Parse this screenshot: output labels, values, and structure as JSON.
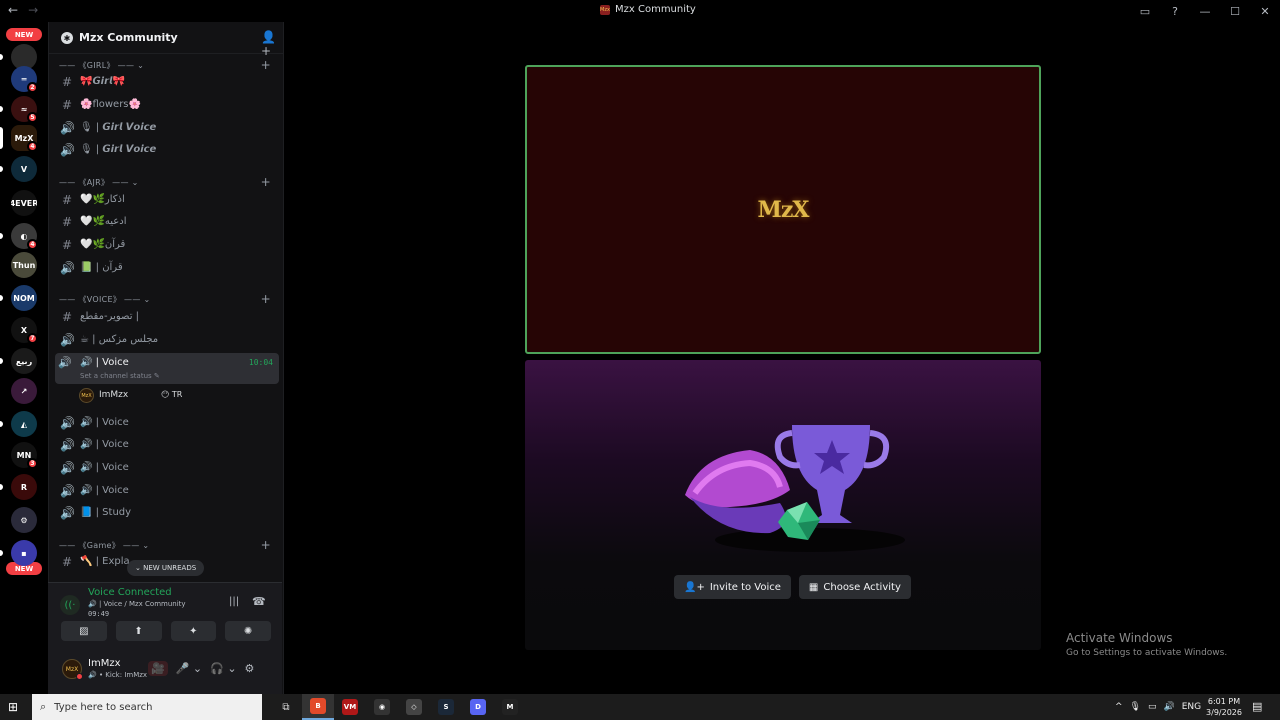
{
  "titlebar": {
    "title": "Mzx Community",
    "back": "←",
    "forward": "→",
    "logo_text": "Mzx",
    "controls": [
      "▭",
      "?",
      "—",
      "☐",
      "✕"
    ]
  },
  "rail": {
    "new_top": "NEW",
    "new_bottom": "NEW",
    "servers": [
      {
        "label": "",
        "color": "#2a2a2a",
        "badge": ""
      },
      {
        "label": "═",
        "color": "#1f3a7a",
        "badge": "2"
      },
      {
        "label": "≈",
        "color": "#3a1010",
        "badge": "5"
      },
      {
        "label": "MzX",
        "color": "#2b1a0a",
        "badge": "4"
      },
      {
        "label": "V",
        "color": "#0e2a3a",
        "badge": ""
      },
      {
        "label": "4EVER",
        "color": "#111111",
        "badge": ""
      },
      {
        "label": "◐",
        "color": "#3a3a3a",
        "badge": "4"
      },
      {
        "label": "Thun",
        "color": "#4a4a3a",
        "badge": ""
      },
      {
        "label": "NOM",
        "color": "#1a3a6a",
        "badge": ""
      },
      {
        "label": "X",
        "color": "#111111",
        "badge": "7"
      },
      {
        "label": "ربيع",
        "color": "#1a1a1a",
        "badge": ""
      },
      {
        "label": "↗",
        "color": "#3a1a3a",
        "badge": ""
      },
      {
        "label": "◭",
        "color": "#0e3a4a",
        "badge": ""
      },
      {
        "label": "MN",
        "color": "#111111",
        "badge": "3"
      },
      {
        "label": "R",
        "color": "#3a0a0a",
        "badge": ""
      },
      {
        "label": "⚙",
        "color": "#2a2a3a",
        "badge": ""
      },
      {
        "label": "▪",
        "color": "#3a3aaa",
        "badge": ""
      }
    ]
  },
  "guild": {
    "name": "Mzx Community",
    "chevron": "⌄",
    "invite_icon": "👤+"
  },
  "categories": [
    {
      "label": "—— 《GIRL》 —— ⌄"
    },
    {
      "label": "—— 《AJR》 —— ⌄"
    },
    {
      "label": "—— 《VOICE》 —— ⌄"
    },
    {
      "label": "—— 《Game》 —— ⌄"
    }
  ],
  "channels": {
    "girl": [
      {
        "icon": "#",
        "name": "🎀𝙂𝙞𝙧𝙡🎀"
      },
      {
        "icon": "#",
        "name": "🌸flowers🌸"
      },
      {
        "icon": "🔊",
        "name": "🎙 | 𝙂𝙞𝙧𝙡 𝙑𝙤𝙞𝙘𝙚"
      },
      {
        "icon": "🔊",
        "name": "🎙 | 𝙂𝙞𝙧𝙡 𝙑𝙤𝙞𝙘𝙚"
      }
    ],
    "ajr": [
      {
        "icon": "#",
        "name": "🤍🌿اذكار"
      },
      {
        "icon": "#",
        "name": "🤍🌿ادعيه"
      },
      {
        "icon": "#",
        "name": "🤍🌿قرآن"
      },
      {
        "icon": "🔊",
        "name": "📗 | قرآن"
      }
    ],
    "voice_text": [
      {
        "icon": "#",
        "name": "تصوير-مقطع |"
      },
      {
        "icon": "🔊",
        "name": "☕ | مجلس مزكس"
      }
    ],
    "active": {
      "icon": "🔊",
      "name": "🔊 | Voice",
      "time": "10:04",
      "status": "Set a channel status ✎"
    },
    "voice_user": {
      "avatar": "MzX",
      "name": "ImMzx",
      "tag": "😶 TR"
    },
    "voice_rest": [
      {
        "icon": "🔊",
        "name": "🔊 | Voice"
      },
      {
        "icon": "🔊",
        "name": "🔊 | Voice"
      },
      {
        "icon": "🔊",
        "name": "🔊 | Voice"
      },
      {
        "icon": "🔊",
        "name": "🔊 | Voice"
      },
      {
        "icon": "🔊",
        "name": "📘 | Study"
      }
    ],
    "game": [
      {
        "icon": "#",
        "name": "🪓 | Expla"
      }
    ]
  },
  "new_unreads": "⌄ NEW UNREADS",
  "voice_panel": {
    "title": "Voice Connected",
    "subtitle": "🔊 | Voice / Mzx Community",
    "time": "09:49",
    "signal_icon": "((·",
    "wave_icon": "|||",
    "hangup_icon": "☎",
    "buttons": [
      "▨",
      "⬆",
      "✦",
      "✺"
    ]
  },
  "user_panel": {
    "avatar": "MzX",
    "name": "ImMzx",
    "sub": "🔊 • Kick: ImMzx",
    "icons": [
      "🎥",
      "🎤 ⌄",
      "🎧 ⌄",
      "⚙"
    ]
  },
  "stage": {
    "tile_logo": "MzX",
    "invite_label": "Invite to Voice",
    "activity_label": "Choose Activity",
    "invite_icon": "👤+",
    "activity_icon": "▦"
  },
  "watermark": {
    "line1": "Activate Windows",
    "line2": "Go to Settings to activate Windows."
  },
  "taskbar": {
    "start_icon": "⊞",
    "search_placeholder": "Type here to search",
    "search_icon": "⌕",
    "taskview_icon": "⧉",
    "apps": [
      {
        "name": "brave",
        "label": "B",
        "color": "#e24a2a",
        "active": true
      },
      {
        "name": "voicemeeter",
        "label": "VM",
        "color": "#b01818",
        "active": false
      },
      {
        "name": "obs",
        "label": "◉",
        "color": "#333333",
        "active": false
      },
      {
        "name": "unity",
        "label": "◇",
        "color": "#444444",
        "active": false
      },
      {
        "name": "steam",
        "label": "S",
        "color": "#1b2838",
        "active": false
      },
      {
        "name": "discord",
        "label": "D",
        "color": "#5865f2",
        "active": false
      },
      {
        "name": "epic",
        "label": "M",
        "color": "#222222",
        "active": false
      }
    ],
    "tray": [
      "^",
      "🎙",
      "▭",
      "🔊",
      "ENG"
    ],
    "time": "6:01 PM",
    "date": "3/9/2026",
    "notif_icon": "▤"
  }
}
